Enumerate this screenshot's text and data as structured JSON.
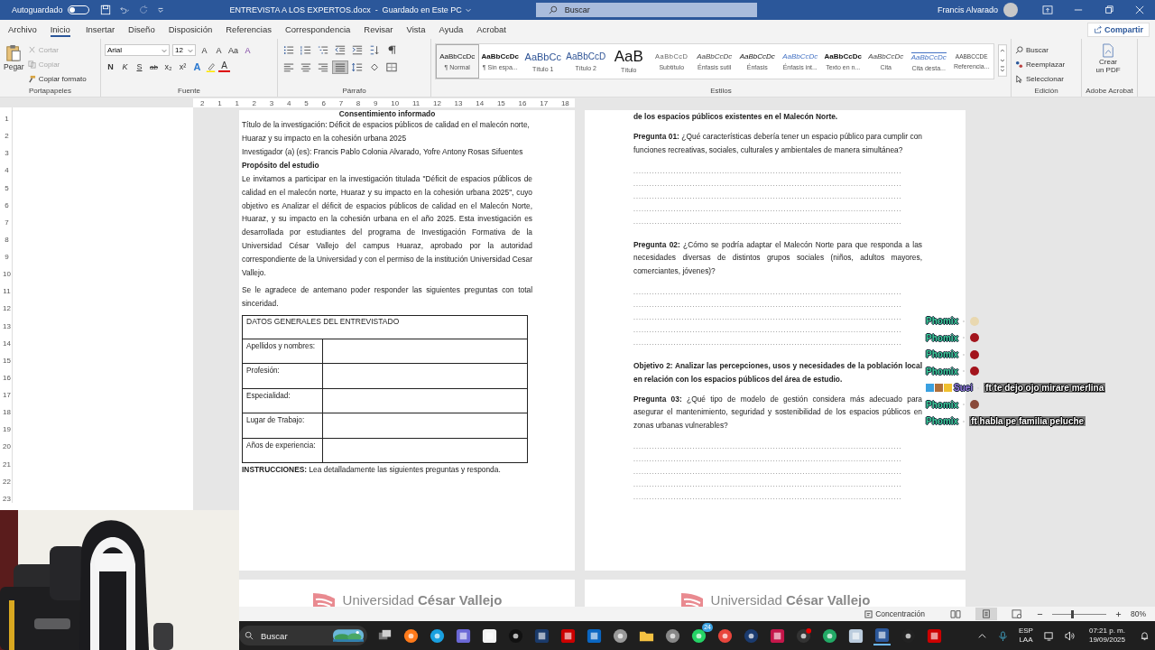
{
  "title_bar": {
    "autosave_label": "Autoguardado",
    "autosave_on": false,
    "document_title": "ENTREVISTA A LOS EXPERTOS.docx  -  Guardado en Este PC",
    "search_placeholder": "Buscar",
    "user_name": "Francis Alvarado"
  },
  "tabs": [
    {
      "label": "Archivo",
      "selected": false
    },
    {
      "label": "Inicio",
      "selected": true
    },
    {
      "label": "Insertar",
      "selected": false
    },
    {
      "label": "Diseño",
      "selected": false
    },
    {
      "label": "Disposición",
      "selected": false
    },
    {
      "label": "Referencias",
      "selected": false
    },
    {
      "label": "Correspondencia",
      "selected": false
    },
    {
      "label": "Revisar",
      "selected": false
    },
    {
      "label": "Vista",
      "selected": false
    },
    {
      "label": "Ayuda",
      "selected": false
    },
    {
      "label": "Acrobat",
      "selected": false
    }
  ],
  "share_button": "Compartir",
  "clipboard": {
    "paste": "Pegar",
    "cut": "Cortar",
    "copy": "Copiar",
    "format_painter": "Copiar formato",
    "group": "Portapapeles"
  },
  "font": {
    "family": "Arial",
    "size": "12",
    "grow": "A",
    "shrink": "A",
    "case": "Aa",
    "clear": "A",
    "buttons": [
      {
        "kind": "bold",
        "label": "N"
      },
      {
        "kind": "italic",
        "label": "K"
      },
      {
        "kind": "underline",
        "label": "S"
      },
      {
        "kind": "strike",
        "label": "ab"
      },
      {
        "kind": "sub",
        "label": "x₂"
      },
      {
        "kind": "sup",
        "label": "x²"
      },
      {
        "kind": "effects",
        "label": "A"
      },
      {
        "kind": "color",
        "label": "A"
      }
    ],
    "group": "Fuente"
  },
  "paragraph": {
    "align_buttons": [
      {
        "kind": "left",
        "selected": false
      },
      {
        "kind": "center",
        "selected": false
      },
      {
        "kind": "right",
        "selected": false
      },
      {
        "kind": "justify",
        "selected": true
      }
    ],
    "group": "Párrafo"
  },
  "styles": {
    "items": [
      {
        "preview": "AaBbCcDc",
        "label": "¶ Normal",
        "kind": "normal",
        "selected": true
      },
      {
        "preview": "AaBbCcDc",
        "label": "¶ Sin espa...",
        "kind": "strong",
        "selected": false
      },
      {
        "preview": "AaBbCc",
        "label": "Título 1",
        "kind": "heading",
        "selected": false
      },
      {
        "preview": "AaBbCcD",
        "label": "Título 2",
        "kind": "heading2",
        "selected": false
      },
      {
        "preview": "AaB",
        "label": "Título",
        "kind": "title",
        "selected": false
      },
      {
        "preview": "AaBbCcD",
        "label": "Subtítulo",
        "kind": "subtitle",
        "selected": false
      },
      {
        "preview": "AaBbCcDc",
        "label": "Énfasis sutil",
        "kind": "subtle",
        "selected": false
      },
      {
        "preview": "AaBbCcDc",
        "label": "Énfasis",
        "kind": "emphasis",
        "selected": false
      },
      {
        "preview": "AaBbCcDc",
        "label": "Énfasis int...",
        "kind": "intense",
        "selected": false
      },
      {
        "preview": "AaBbCcDc",
        "label": "Texto en n...",
        "kind": "strong",
        "selected": false
      },
      {
        "preview": "AaBbCcDc",
        "label": "Cita",
        "kind": "subtle",
        "selected": false
      },
      {
        "preview": "AaBbCcDc",
        "label": "Cita desta...",
        "kind": "quote",
        "selected": false
      },
      {
        "preview": "AABBCCDE",
        "label": "Referencia...",
        "kind": "caps",
        "selected": false
      }
    ],
    "group": "Estilos"
  },
  "editing": {
    "find": "Buscar",
    "replace": "Reemplazar",
    "select": "Seleccionar",
    "group": "Edición"
  },
  "acrobat": {
    "create": "Crear un PDF",
    "group": "Adobe Acrobat"
  },
  "ruler": [
    "2",
    "1",
    "1",
    "2",
    "3",
    "4",
    "5",
    "6",
    "7",
    "8",
    "9",
    "10",
    "11",
    "12",
    "13",
    "14",
    "15",
    "16",
    "17",
    "18"
  ],
  "vertical_ruler": [
    "1",
    "2",
    "3",
    "4",
    "5",
    "6",
    "7",
    "8",
    "9",
    "10",
    "11",
    "12",
    "13",
    "14",
    "15",
    "16",
    "17",
    "18",
    "19",
    "20",
    "21",
    "22",
    "23"
  ],
  "left_page": {
    "heading": "Consentimiento informado",
    "lines": [
      "Título de la investigación: Déficit de espacios públicos de calidad en el malecón norte, Huaraz y su impacto en la cohesión urbana 2025",
      "Investigador (a) (es): Francis Pablo Colonia Alvarado, Yofre Antony Rosas Sifuentes"
    ],
    "purpose_title": "Propósito del estudio",
    "purpose": "Le invitamos a participar en la investigación titulada \"Déficit de espacios públicos de calidad en el malecón norte, Huaraz y su impacto en la cohesión urbana 2025\", cuyo objetivo es Analizar el déficit de espacios públicos de calidad en el Malecón Norte, Huaraz, y su impacto en la cohesión urbana en el año 2025. Esta investigación es desarrollada por estudiantes del programa de Investigación Formativa de la Universidad César Vallejo del campus Huaraz, aprobado por la autoridad correspondiente de la Universidad y con el permiso de la institución Universidad Cesar Vallejo.",
    "thanks": "Se le agradece de antemano poder responder las siguientes preguntas con total sinceridad.",
    "table": {
      "title": "DATOS GENERALES DEL ENTREVISTADO",
      "rows": [
        "Apellidos y nombres:",
        "Profesión:",
        "Especialidad:",
        "Lugar de Trabajo:",
        "Años de experiencia:"
      ]
    },
    "instructions": "**INSTRUCCIONES:** Lea detalladamente las siguientes preguntas y responda."
  },
  "right_page": {
    "heading": "de los espacios públicos existentes en el Malecón Norte.",
    "blocks": [
      {
        "kind": "question",
        "text": "**Pregunta 01:** ¿Qué características debería tener un espacio público para cumplir con funciones recreativas, sociales, culturales y ambientales de manera simultánea?",
        "answer_lines": [
          "....................................................................................................",
          "....................................................................................................",
          "....................................................................................................",
          "....................................................................................................",
          "...................................................................................................."
        ]
      },
      {
        "kind": "question",
        "text": "**Pregunta 02:** ¿Cómo se podría adaptar el Malecón Norte para que responda a las necesidades diversas de distintos grupos sociales (niños, adultos mayores, comerciantes, jóvenes)?",
        "answer_lines": [
          "....................................................................................................",
          "....................................................................................................",
          "....................................................................................................",
          "....................................................................................................",
          "...................................................................................................."
        ]
      },
      {
        "kind": "objective",
        "text": "Objetivo 2: Analizar las percepciones, usos y necesidades de la población local en relación con los espacios públicos del área de estudio."
      },
      {
        "kind": "question",
        "text": "**Pregunta 03:** ¿Qué tipo de modelo de gestión considera más adecuado para asegurar el mantenimiento, seguridad y sostenibilidad de los espacios públicos en zonas urbanas vulnerables?",
        "answer_lines": [
          "....................................................................................................",
          "....................................................................................................",
          "....................................................................................................",
          "....................................................................................................",
          "...................................................................................................."
        ]
      }
    ]
  },
  "footer_logo": [
    "Universidad **César Vallejo**",
    "Universidad **César Vallejo**"
  ],
  "chat": [
    {
      "user": "Phomix",
      "kind": "emote",
      "color": "#3fcf9c"
    },
    {
      "user": "Phomix",
      "kind": "emote",
      "color": "#3fcf9c"
    },
    {
      "user": "Phomix",
      "kind": "emote",
      "color": "#3fcf9c"
    },
    {
      "user": "Phomix",
      "kind": "emote",
      "color": "#3fcf9c"
    },
    {
      "user": "Suei",
      "kind": "text",
      "color": "#9a7ae0",
      "badges": true,
      "text": "ft te dejo ojo mirare merlina"
    },
    {
      "user": "Phomix",
      "kind": "emote",
      "color": "#3fcf9c"
    },
    {
      "user": "Phomix",
      "kind": "text",
      "color": "#3fcf9c",
      "text": "ft habla pe familia peluche"
    }
  ],
  "status_bar": {
    "focus": "Concentración",
    "zoom": "80%",
    "zoom_slider": {
      "level": 0.35
    },
    "views": [
      {
        "kind": "read",
        "selected": false
      },
      {
        "kind": "print",
        "selected": true
      },
      {
        "kind": "web",
        "selected": false
      }
    ]
  },
  "taskbar": {
    "search": "Buscar",
    "chat_badge": "24",
    "language": "ESP",
    "layout": "LAA",
    "time": "07:21 p. m.",
    "date": "19/09/2025"
  }
}
